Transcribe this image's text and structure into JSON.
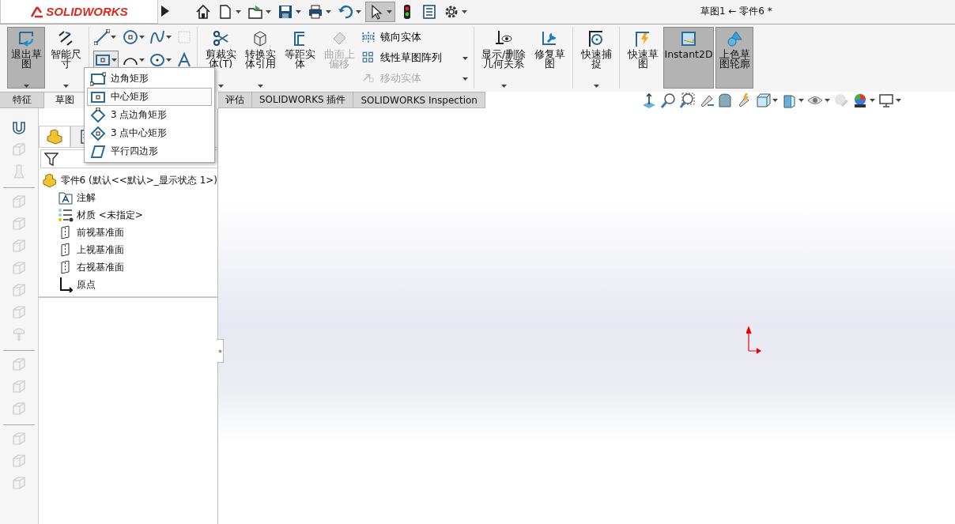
{
  "title_bar": {
    "logo": "SOLIDWORKS",
    "document_title": "草图1 ← 零件6 *"
  },
  "ribbon": {
    "groups": [
      {
        "large": [
          {
            "label": "退出草图",
            "kind": "exit",
            "pressed": true,
            "caret": true
          },
          {
            "label": "智能尺寸",
            "kind": "dimension",
            "pressed": false,
            "caret": true
          }
        ]
      },
      {
        "kind": "tools"
      },
      {
        "large": [
          {
            "label": "剪裁实体(T)",
            "kind": "trim",
            "pressed": false,
            "caret": true
          },
          {
            "label": "转换实体引用",
            "kind": "convert",
            "pressed": false,
            "caret": true
          },
          {
            "label": "等距实体",
            "kind": "offset",
            "pressed": false,
            "caret": false
          },
          {
            "label": "曲面上偏移",
            "kind": "surface",
            "pressed": false,
            "caret": false,
            "disabled": true
          }
        ],
        "small": [
          {
            "label": "镜向实体",
            "kind": "mirror",
            "disabled": false,
            "caret": false
          },
          {
            "label": "线性草图阵列",
            "kind": "pattern",
            "disabled": false,
            "caret": true
          },
          {
            "label": "移动实体",
            "kind": "move",
            "disabled": true,
            "caret": true
          }
        ]
      },
      {
        "large": [
          {
            "label": "显示/删除几何关系",
            "kind": "relations",
            "pressed": false,
            "caret": true
          },
          {
            "label": "修复草图",
            "kind": "repair",
            "pressed": false,
            "caret": false
          }
        ]
      },
      {
        "large": [
          {
            "label": "快速捕捉",
            "kind": "snap",
            "pressed": false,
            "caret": true
          }
        ]
      },
      {
        "large": [
          {
            "label": "快速草图",
            "kind": "rapid",
            "pressed": false,
            "caret": false
          },
          {
            "label": "Instant2D",
            "kind": "instant",
            "pressed": true,
            "caret": false
          },
          {
            "label": "上色草图轮廓",
            "kind": "shaded",
            "pressed": true,
            "caret": false
          }
        ]
      }
    ]
  },
  "tabs": [
    {
      "label": "特征",
      "selected": false
    },
    {
      "label": "草图",
      "selected": true
    },
    {
      "label": "评估",
      "selected": false
    },
    {
      "label": "SOLIDWORKS 插件",
      "selected": false
    },
    {
      "label": "SOLIDWORKS Inspection",
      "selected": false
    }
  ],
  "rectangle_menu": [
    {
      "label": "边角矩形",
      "kind": "corner",
      "selected": false
    },
    {
      "label": "中心矩形",
      "kind": "center",
      "selected": true
    },
    {
      "label": "3 点边角矩形",
      "kind": "three-corner",
      "selected": false
    },
    {
      "label": "3 点中心矩形",
      "kind": "three-center",
      "selected": false
    },
    {
      "label": "平行四边形",
      "kind": "parallelogram",
      "selected": false
    }
  ],
  "feature_tree": {
    "label": "零件6  (默认<<默认>_显示状态 1>)",
    "kind": "part",
    "children": [
      {
        "label": "注解",
        "kind": "annotation"
      },
      {
        "label": "材质 <未指定>",
        "kind": "material"
      },
      {
        "label": "前视基准面",
        "kind": "plane"
      },
      {
        "label": "上视基准面",
        "kind": "plane"
      },
      {
        "label": "右视基准面",
        "kind": "plane"
      },
      {
        "label": "原点",
        "kind": "origin"
      }
    ]
  }
}
